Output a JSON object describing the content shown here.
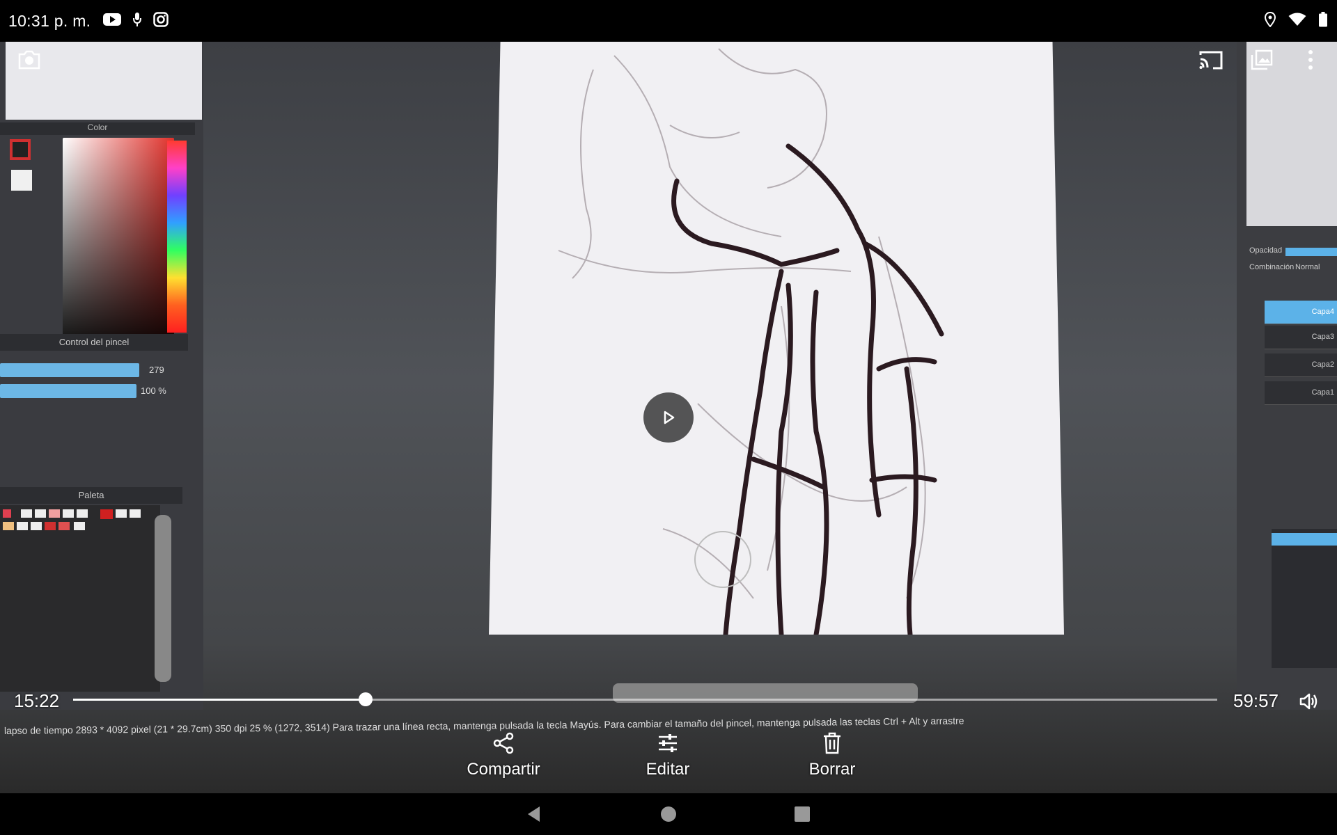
{
  "status_bar": {
    "time": "10:31 p. m.",
    "left_icons": [
      "youtube-icon",
      "microphone-icon",
      "instagram-icon"
    ],
    "right_icons": [
      "location-icon",
      "wifi-icon",
      "battery-icon"
    ]
  },
  "video": {
    "top_left_icons": [
      "screenshot-camera-icon"
    ],
    "top_right_icons": [
      "cast-icon",
      "gallery-icon",
      "more-options-icon"
    ],
    "current_time": "15:22",
    "total_time": "59:57",
    "progress": 0.2559
  },
  "recording_content": {
    "color_panel_title": "Color",
    "brush_panel_title": "Control del pincel",
    "brush_size": "279",
    "brush_opacity": "100 %",
    "palette_title": "Paleta",
    "layer_opacity_label": "Opacidad",
    "layer_blend_label": "Combinación",
    "layer_blend_value": "Normal",
    "layers": [
      "Capa4",
      "Capa3",
      "Capa2",
      "Capa1"
    ],
    "status_text": "lapso de tiempo   2893 * 4092 pixel   (21 * 29.7cm)   350 dpi   25 %   (1272, 3514)   Para trazar una línea recta, mantenga pulsada la tecla Mayús. Para cambiar el tamaño del pincel, mantenga pulsada las teclas Ctrl + Alt y arrastre"
  },
  "actions": {
    "share": "Compartir",
    "edit": "Editar",
    "delete": "Borrar"
  },
  "nav": [
    "back-icon",
    "home-icon",
    "recents-icon"
  ],
  "colors": {
    "background": "#000000",
    "accent_blue": "#5cb2e8"
  }
}
